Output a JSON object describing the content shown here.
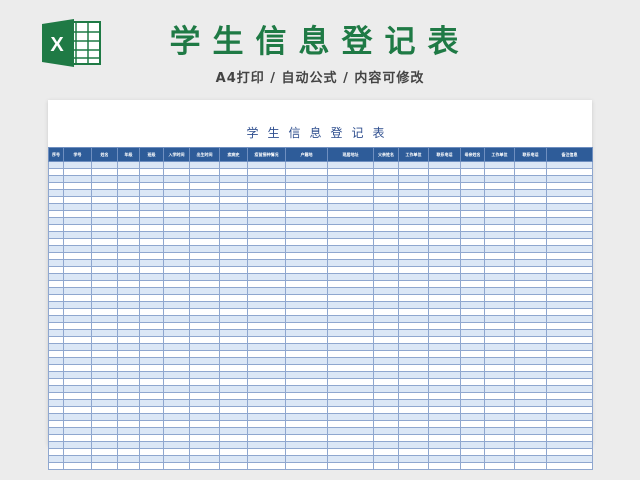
{
  "header": {
    "title": "学生信息登记表",
    "subtitle": "A4打印 / 自动公式 / 内容可修改"
  },
  "logo": {
    "letter": "X",
    "color": "#1f7a45"
  },
  "sheet": {
    "title": "学生信息登记表",
    "columns": [
      "序号",
      "学号",
      "姓名",
      "年级",
      "班级",
      "入学时间",
      "出生时间",
      "疾病史",
      "疫苗接种情况",
      "户籍地",
      "现居地址",
      "父亲姓名",
      "工作单位",
      "联系电话",
      "母亲姓名",
      "工作单位",
      "联系电话",
      "备注信息"
    ],
    "row_count": 44,
    "header_color": "#2e5c99",
    "stripe_color": "#dbe7f6"
  }
}
